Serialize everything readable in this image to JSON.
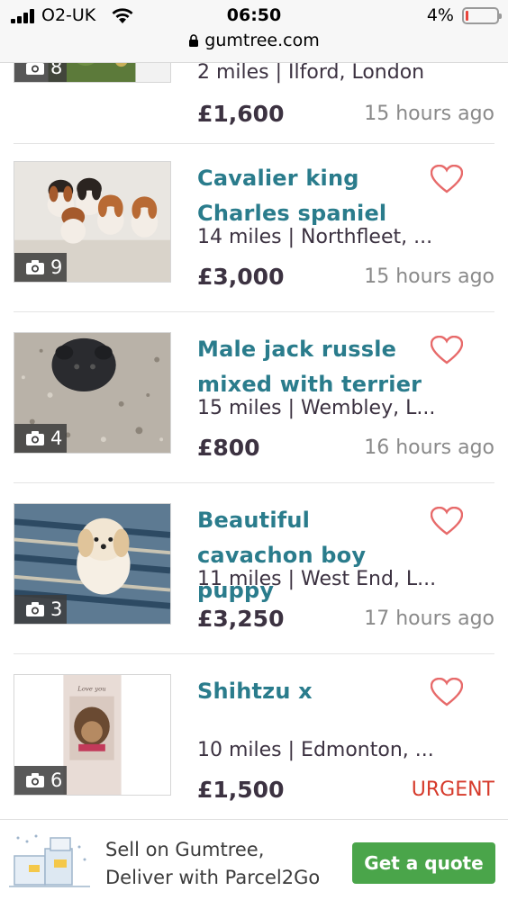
{
  "status_bar": {
    "carrier": "O2-UK",
    "time": "06:50",
    "battery_pct": "4%",
    "battery_level": 0.04,
    "icons": [
      "signal-icon",
      "wifi-icon",
      "battery-icon"
    ]
  },
  "url_bar": {
    "url": "gumtree.com",
    "icon": "lock-icon"
  },
  "colors": {
    "title": "#2a7c8c",
    "heart": "#e76a6a",
    "urgent": "#d63a2b",
    "cta": "#4aa54a"
  },
  "listings": [
    {
      "title": "",
      "location": "2 miles | Ilford, London",
      "price": "£1,600",
      "age": "15 hours ago",
      "photo_count": "8"
    },
    {
      "title": "Cavalier king Charles spaniel",
      "location": "14 miles | Northfleet, ...",
      "price": "£3,000",
      "age": "15 hours ago",
      "photo_count": "9"
    },
    {
      "title": "Male jack russle mixed with terrier",
      "location": "15 miles | Wembley, L...",
      "price": "£800",
      "age": "16 hours ago",
      "photo_count": "4"
    },
    {
      "title": "Beautiful cavachon boy puppy",
      "location": "11 miles | West End, L...",
      "price": "£3,250",
      "age": "17 hours ago",
      "photo_count": "3"
    },
    {
      "title": "Shihtzu x",
      "location": "10 miles | Edmonton, ...",
      "price": "£1,500",
      "age": "URGENT",
      "photo_count": "6",
      "photo_caption": "Love you"
    }
  ],
  "banner": {
    "line1": "Sell on Gumtree,",
    "line2": "Deliver with Parcel2Go",
    "cta": "Get a quote"
  }
}
